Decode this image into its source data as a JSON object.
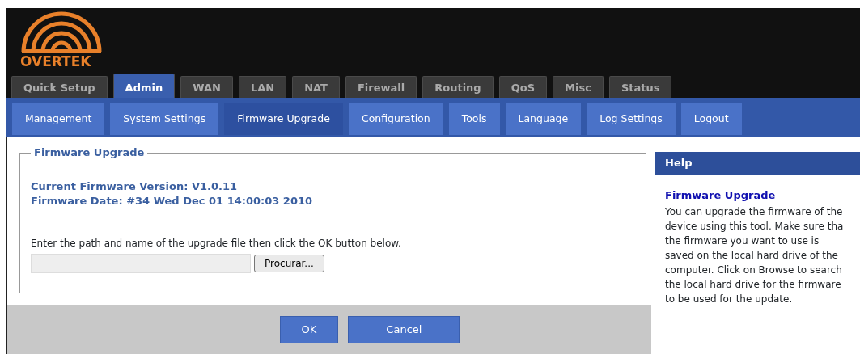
{
  "logo": {
    "text": "OVERTEK"
  },
  "main_tabs": [
    {
      "label": "Quick Setup",
      "selected": false
    },
    {
      "label": "Admin",
      "selected": true
    },
    {
      "label": "WAN",
      "selected": false
    },
    {
      "label": "LAN",
      "selected": false
    },
    {
      "label": "NAT",
      "selected": false
    },
    {
      "label": "Firewall",
      "selected": false
    },
    {
      "label": "Routing",
      "selected": false
    },
    {
      "label": "QoS",
      "selected": false
    },
    {
      "label": "Misc",
      "selected": false
    },
    {
      "label": "Status",
      "selected": false
    }
  ],
  "sub_tabs": [
    {
      "label": "Management",
      "selected": false
    },
    {
      "label": "System Settings",
      "selected": false
    },
    {
      "label": "Firmware Upgrade",
      "selected": true
    },
    {
      "label": "Configuration",
      "selected": false
    },
    {
      "label": "Tools",
      "selected": false
    },
    {
      "label": "Language",
      "selected": false
    },
    {
      "label": "Log Settings",
      "selected": false
    },
    {
      "label": "Logout",
      "selected": false
    }
  ],
  "panel": {
    "legend": "Firmware Upgrade",
    "version": "Current Firmware Version: V1.0.11",
    "date": "Firmware Date: #34 Wed Dec 01 14:00:03 2010",
    "instruction": "Enter the path and name of the upgrade file then click the OK button below.",
    "browse_button": "Procurar..."
  },
  "buttons": [
    "OK",
    "Cancel"
  ],
  "help": {
    "header": "Help",
    "title": "Firmware Upgrade",
    "lines": [
      "You can upgrade the firmware of the",
      "device using this tool. Make sure tha",
      "the firmware you want to use is",
      "saved on the local hard drive of the",
      "computer. Click on Browse to search",
      "the local hard drive for the firmware",
      "to be used for the update."
    ]
  }
}
